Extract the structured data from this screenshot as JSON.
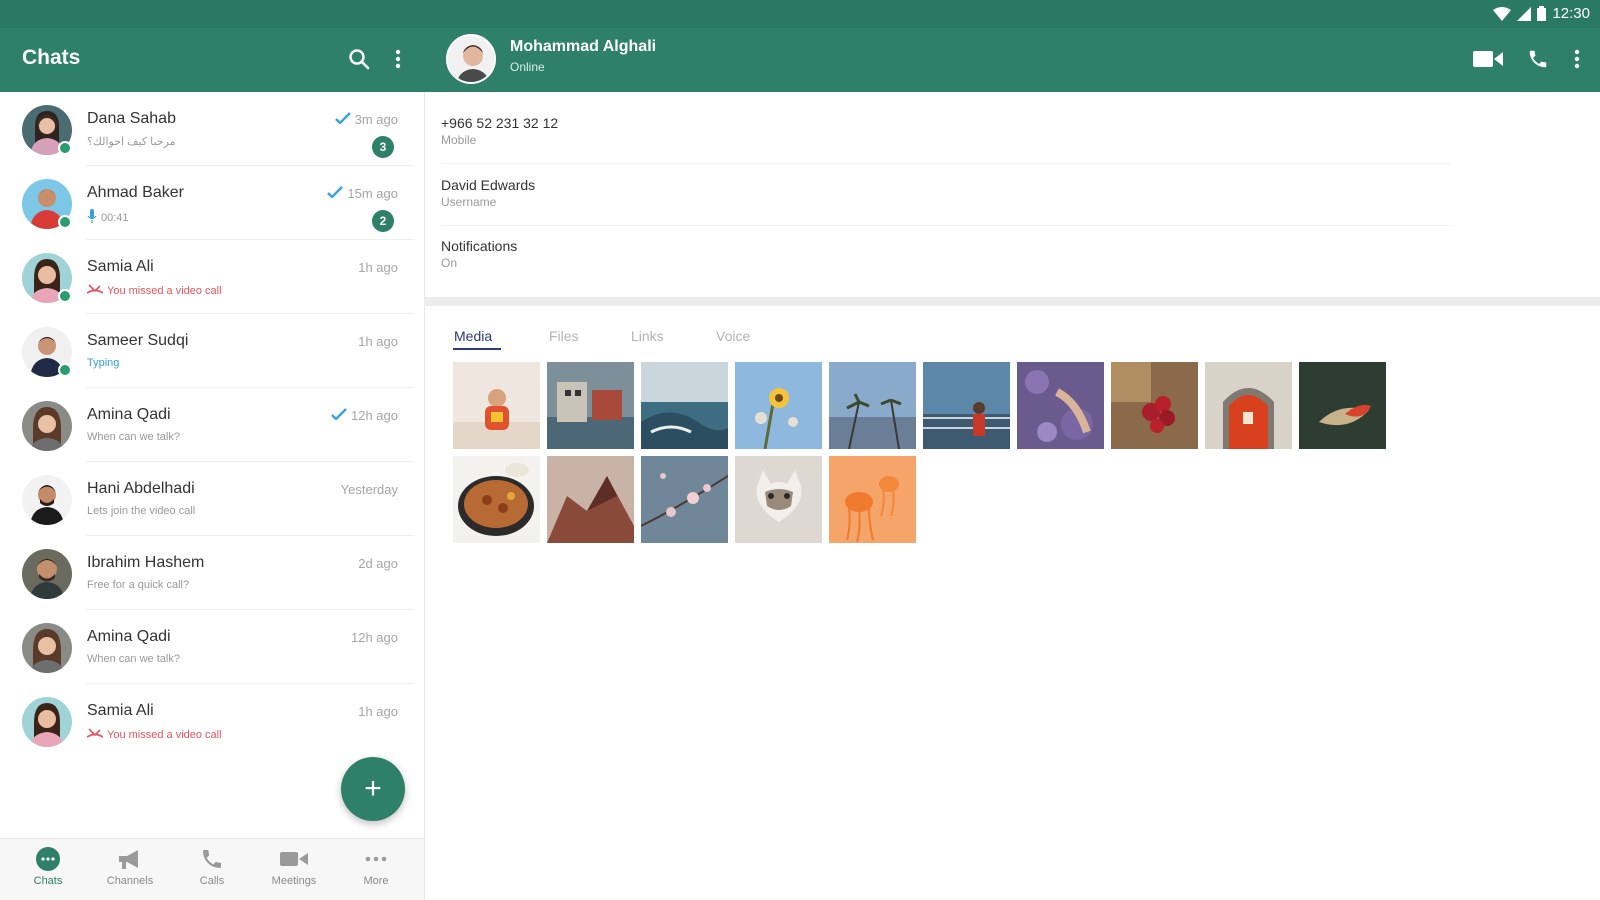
{
  "status_bar": {
    "time": "12:30"
  },
  "left_header": {
    "title": "Chats"
  },
  "right_header": {
    "name": "Mohammad Alghali",
    "status": "Online"
  },
  "chats": [
    {
      "name": "Dana Sahab",
      "subtitle": "مرحبا كيف احوالك؟",
      "time": "3m ago",
      "badge": "3",
      "read": true,
      "online": true,
      "kind": "text"
    },
    {
      "name": "Ahmad Baker",
      "subtitle": "00:41",
      "time": "15m ago",
      "badge": "2",
      "read": true,
      "online": true,
      "kind": "voice"
    },
    {
      "name": "Samia Ali",
      "subtitle": "You missed a video call",
      "time": "1h ago",
      "badge": "",
      "read": false,
      "online": true,
      "kind": "missed"
    },
    {
      "name": "Sameer Sudqi",
      "subtitle": "Typing",
      "time": "1h ago",
      "badge": "",
      "read": false,
      "online": true,
      "kind": "typing"
    },
    {
      "name": "Amina Qadi",
      "subtitle": "When can we talk?",
      "time": "12h ago",
      "badge": "",
      "read": true,
      "online": false,
      "kind": "text"
    },
    {
      "name": "Hani Abdelhadi",
      "subtitle": "Lets join the video call",
      "time": "Yesterday",
      "badge": "",
      "read": false,
      "online": false,
      "kind": "text"
    },
    {
      "name": "Ibrahim Hashem",
      "subtitle": "Free for a quick call?",
      "time": "2d ago",
      "badge": "",
      "read": false,
      "online": false,
      "kind": "text"
    },
    {
      "name": "Amina Qadi",
      "subtitle": "When can we talk?",
      "time": "12h ago",
      "badge": "",
      "read": false,
      "online": false,
      "kind": "text"
    },
    {
      "name": "Samia Ali",
      "subtitle": "You missed a video call",
      "time": "1h ago",
      "badge": "",
      "read": false,
      "online": false,
      "kind": "missed"
    }
  ],
  "fab": {
    "label": "+"
  },
  "bottom_nav": [
    {
      "label": "Chats",
      "icon": "chat-bubble-icon",
      "active": true
    },
    {
      "label": "Channels",
      "icon": "megaphone-icon",
      "active": false
    },
    {
      "label": "Calls",
      "icon": "phone-icon",
      "active": false
    },
    {
      "label": "Meetings",
      "icon": "video-camera-icon",
      "active": false
    },
    {
      "label": "More",
      "icon": "more-horizontal-icon",
      "active": false
    }
  ],
  "details": {
    "phone": {
      "value": "+966 52 231 32 12",
      "label": "Mobile"
    },
    "username": {
      "value": "David Edwards",
      "label": "Username"
    },
    "notifications": {
      "value": "Notifications",
      "label": "On"
    }
  },
  "tabs": [
    "Media",
    "Files",
    "Links",
    "Voice"
  ],
  "active_tab": "Media",
  "media_thumbnails": [
    "child-photo",
    "harbor-photo",
    "coast-photo",
    "sunflower-photo",
    "palm-trees-photo",
    "balcony-photo",
    "hand-flowers-photo",
    "cherries-photo",
    "red-door-photo",
    "leaf-photo",
    "food-photo",
    "red-rock-photo",
    "blossom-photo",
    "cat-photo",
    "jellyfish-photo"
  ],
  "colors": {
    "header": "#2e8068",
    "status_bar": "#2a7a63",
    "badge": "#2e8068",
    "check": "#3aa0dc",
    "missed": "#e05560",
    "active_tab": "#2c3a7a"
  }
}
